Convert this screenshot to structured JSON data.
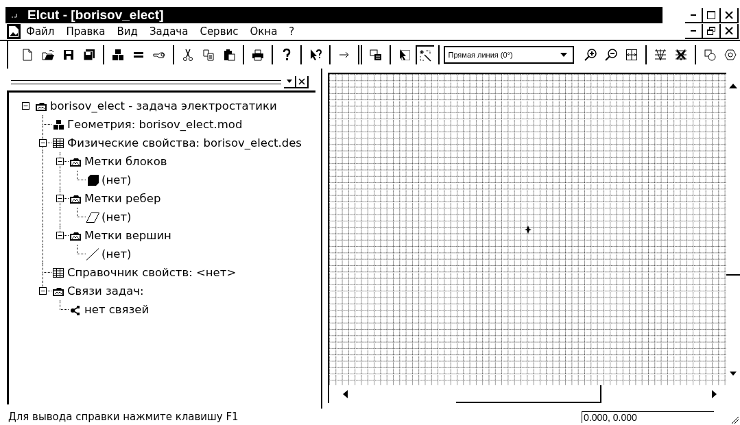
{
  "window": {
    "title": "Elcut - [borisov_elect]"
  },
  "menu": [
    {
      "label": "Файл"
    },
    {
      "label": "Правка"
    },
    {
      "label": "Вид"
    },
    {
      "label": "Задача"
    },
    {
      "label": "Сервис"
    },
    {
      "label": "Окна"
    },
    {
      "label": "?"
    }
  ],
  "toolbar": {
    "select_tool": {
      "selected": false
    },
    "snap_tool": {
      "selected": true
    },
    "shape_combo": {
      "value": "Прямая линия (0°)"
    }
  },
  "tree": [
    {
      "label": "borisov_elect -  задача электростатики",
      "kind": "problem",
      "expanded": true,
      "children": [
        {
          "label": "Геометрия: borisov_elect.mod",
          "kind": "geometry"
        },
        {
          "label": "Физические свойства: borisov_elect.des",
          "kind": "table",
          "expanded": true,
          "children": [
            {
              "label": "Метки блоков",
              "kind": "folder",
              "expanded": true,
              "children": [
                {
                  "label": "(нет)",
                  "kind": "block"
                }
              ]
            },
            {
              "label": "Метки ребер",
              "kind": "folder",
              "expanded": true,
              "children": [
                {
                  "label": "(нет)",
                  "kind": "edge"
                }
              ]
            },
            {
              "label": "Метки вершин",
              "kind": "folder",
              "expanded": true,
              "children": [
                {
                  "label": "(нет)",
                  "kind": "vertex"
                }
              ]
            }
          ]
        },
        {
          "label": "Справочник свойств: <нет>",
          "kind": "table"
        },
        {
          "label": "Связи задач:",
          "kind": "folder",
          "expanded": true,
          "children": [
            {
              "label": "нет связей",
              "kind": "links"
            }
          ]
        }
      ]
    }
  ],
  "status_bar": {
    "message": "Для вывода справки нажмите клавишу F1",
    "coordinates": "0.000, 0.000"
  }
}
